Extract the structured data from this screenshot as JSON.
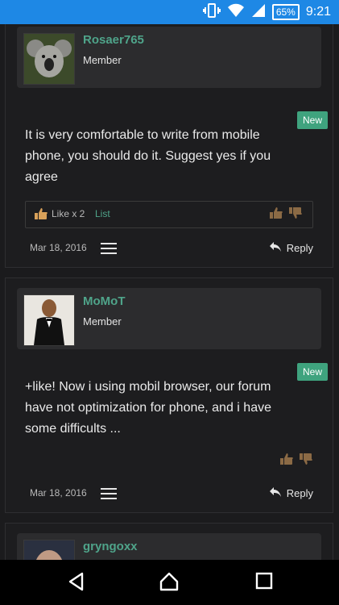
{
  "status_bar": {
    "battery": "65%",
    "time": "9:21"
  },
  "posts": [
    {
      "username": "Rosaer765",
      "role": "Member",
      "badge": "New",
      "text": "It is very comfortable to write from mobile phone, you should do it. Suggest yes if you agree",
      "likes_text": "Like x 2",
      "likes_list": "List",
      "date": "Mar 18, 2016",
      "reply_label": "Reply"
    },
    {
      "username": "MoMoT",
      "role": "Member",
      "badge": "New",
      "text": "+like! Now i using mobil browser, our forum have not optimization for phone, and i have some difficults ...",
      "date": "Mar 18, 2016",
      "reply_label": "Reply"
    },
    {
      "username": "gryngoxx"
    }
  ],
  "icons": {
    "vibrate": "vibrate-icon",
    "wifi": "wifi-icon",
    "signal": "signal-icon",
    "like": "thumbs-up-icon",
    "dislike": "thumbs-down-icon",
    "menu": "hamburger-menu-icon",
    "reply": "reply-arrow-icon",
    "back": "back-triangle-icon",
    "home": "home-icon",
    "recents": "recents-square-icon"
  },
  "colors": {
    "status_bar": "#1e88e5",
    "accent": "#4fa48a",
    "badge": "#3fa37e",
    "background": "#1b1b1d"
  }
}
